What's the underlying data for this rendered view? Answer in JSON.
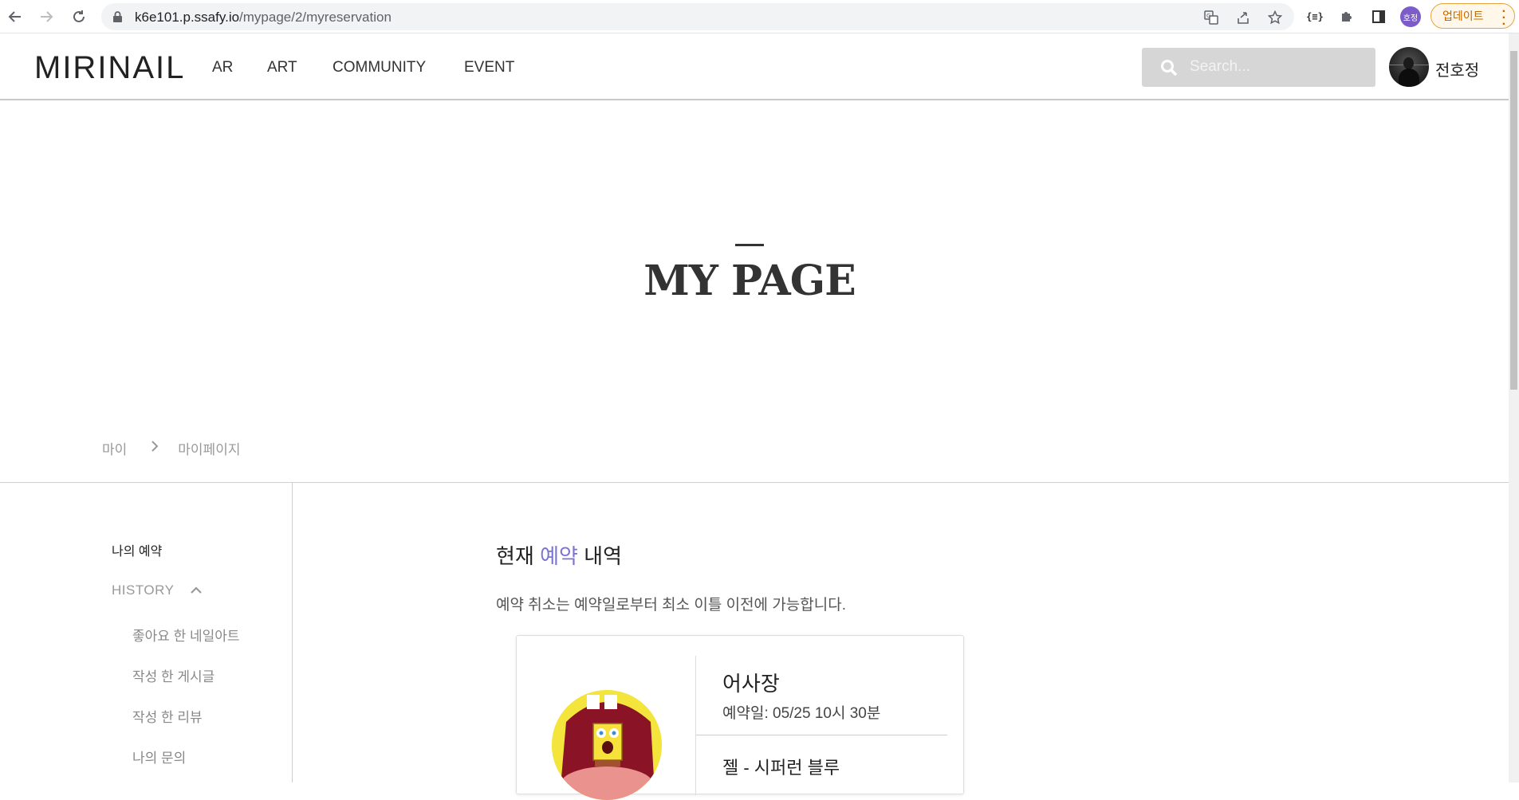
{
  "browser": {
    "url_host": "k6e101.p.ssafy.io",
    "url_path": "/mypage/2/myreservation",
    "profile_initials": "호정",
    "update_label": "업데이트"
  },
  "header": {
    "logo": "MIRINAIL",
    "menu": [
      "AR",
      "ART",
      "COMMUNITY",
      "EVENT"
    ],
    "search_placeholder": "Search...",
    "username": "전호정"
  },
  "hero": {
    "title": "MY PAGE"
  },
  "breadcrumb": {
    "root": "마이",
    "current": "마이페이지"
  },
  "sidebar": {
    "top_item": "나의 예약",
    "history_label": "HISTORY",
    "history_items": [
      "좋아요 한 네일아트",
      "작성 한 게시글",
      "작성 한 리뷰",
      "나의 문의"
    ]
  },
  "content": {
    "title_prefix": "현재 ",
    "title_accent": "예약",
    "title_suffix": " 내역",
    "notice": "예약 취소는 예약일로부터 최소 이틀 이전에 가능합니다.",
    "reservation": {
      "shop_name": "어사장",
      "date_label": "예약일: 05/25 10시 30분",
      "design_name": "젤 - 시퍼런 블루"
    }
  },
  "colors": {
    "accent": "#7b74d1",
    "update_border": "#e8a33d"
  }
}
